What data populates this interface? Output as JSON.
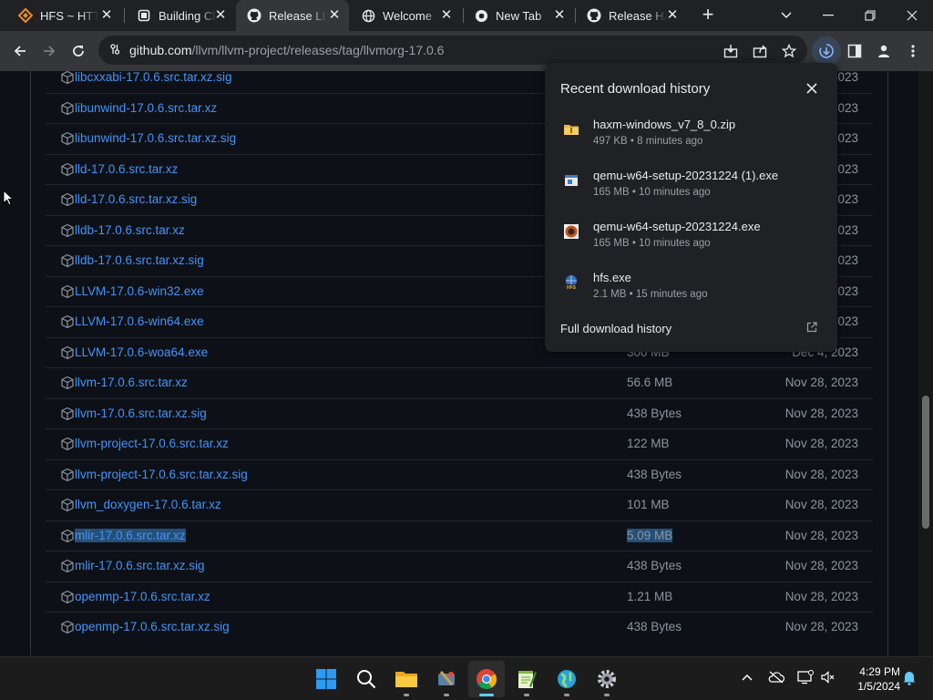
{
  "tabs": [
    {
      "title": "HFS ~ HTTP File Server",
      "icon": "hfs-logo-icon"
    },
    {
      "title": "Building Clang",
      "icon": "document-icon"
    },
    {
      "title": "Release LLVM",
      "icon": "github-icon"
    },
    {
      "title": "Welcome",
      "icon": "globe-icon"
    },
    {
      "title": "New Tab",
      "icon": "chrome-icon"
    },
    {
      "title": "Release HAXM",
      "icon": "github-icon"
    }
  ],
  "active_tab_index": 2,
  "address_bar": {
    "host": "github.com",
    "path": "/llvm/llvm-project/releases/tag/llvmorg-17.0.6"
  },
  "assets": [
    {
      "name": "libcxxabi-17.0.6.src.tar.xz.sig",
      "size": "",
      "date": "2023"
    },
    {
      "name": "libunwind-17.0.6.src.tar.xz",
      "size": "",
      "date": "2023"
    },
    {
      "name": "libunwind-17.0.6.src.tar.xz.sig",
      "size": "",
      "date": "2023"
    },
    {
      "name": "lld-17.0.6.src.tar.xz",
      "size": "",
      "date": "2023"
    },
    {
      "name": "lld-17.0.6.src.tar.xz.sig",
      "size": "",
      "date": "2023"
    },
    {
      "name": "lldb-17.0.6.src.tar.xz",
      "size": "",
      "date": "2023"
    },
    {
      "name": "lldb-17.0.6.src.tar.xz.sig",
      "size": "",
      "date": "2023"
    },
    {
      "name": "LLVM-17.0.6-win32.exe",
      "size": "",
      "date": "2023"
    },
    {
      "name": "LLVM-17.0.6-win64.exe",
      "size": "",
      "date": "2023"
    },
    {
      "name": "LLVM-17.0.6-woa64.exe",
      "size": "300 MB",
      "date": "Dec 4, 2023"
    },
    {
      "name": "llvm-17.0.6.src.tar.xz",
      "size": "56.6 MB",
      "date": "Nov 28, 2023"
    },
    {
      "name": "llvm-17.0.6.src.tar.xz.sig",
      "size": "438 Bytes",
      "date": "Nov 28, 2023"
    },
    {
      "name": "llvm-project-17.0.6.src.tar.xz",
      "size": "122 MB",
      "date": "Nov 28, 2023"
    },
    {
      "name": "llvm-project-17.0.6.src.tar.xz.sig",
      "size": "438 Bytes",
      "date": "Nov 28, 2023"
    },
    {
      "name": "llvm_doxygen-17.0.6.tar.xz",
      "size": "101 MB",
      "date": "Nov 28, 2023"
    },
    {
      "name": "mlir-17.0.6.src.tar.xz",
      "size": "5.09 MB",
      "date": "Nov 28, 2023"
    },
    {
      "name": "mlir-17.0.6.src.tar.xz.sig",
      "size": "438 Bytes",
      "date": "Nov 28, 2023"
    },
    {
      "name": "openmp-17.0.6.src.tar.xz",
      "size": "1.21 MB",
      "date": "Nov 28, 2023"
    },
    {
      "name": "openmp-17.0.6.src.tar.xz.sig",
      "size": "438 Bytes",
      "date": "Nov 28, 2023"
    }
  ],
  "download_bubble": {
    "title": "Recent download history",
    "items": [
      {
        "name": "haxm-windows_v7_8_0.zip",
        "meta": "497 KB • 8 minutes ago",
        "icon": "zip-folder-icon"
      },
      {
        "name": "qemu-w64-setup-20231224 (1).exe",
        "meta": "165 MB • 10 minutes ago",
        "icon": "installer-icon"
      },
      {
        "name": "qemu-w64-setup-20231224.exe",
        "meta": "165 MB • 10 minutes ago",
        "icon": "qemu-icon"
      },
      {
        "name": "hfs.exe",
        "meta": "2.1 MB • 15 minutes ago",
        "icon": "hfs-app-icon"
      }
    ],
    "footer": "Full download history"
  },
  "taskbar": {
    "apps": [
      "start",
      "search",
      "file-explorer",
      "app-4",
      "chrome",
      "notepadpp",
      "app-7",
      "settings"
    ],
    "time": "4:29 PM",
    "date": "1/5/2024"
  },
  "colors": {
    "page_bg": "#0d1117",
    "link": "#4493f8",
    "muted": "#8b949e",
    "selection": "#264f78",
    "chrome_dark": "#202124",
    "chrome_toolbar": "#35363a"
  }
}
